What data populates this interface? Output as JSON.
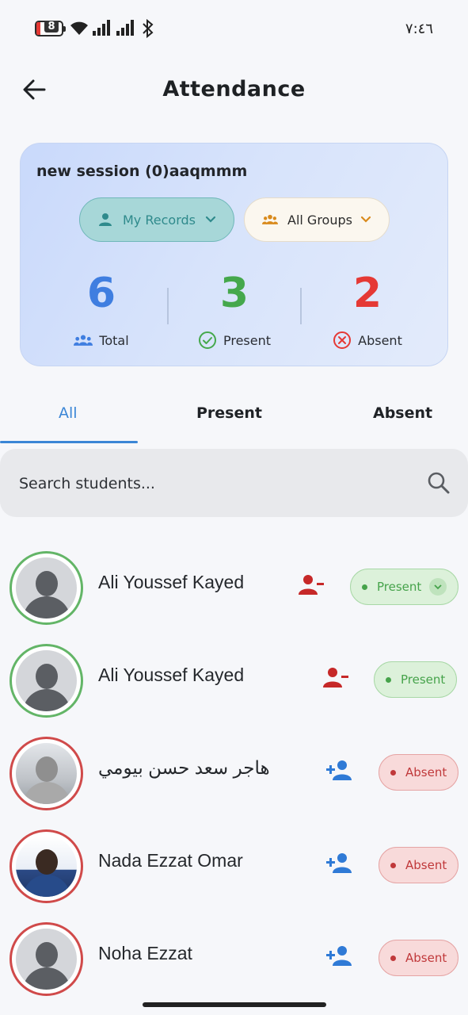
{
  "status_bar": {
    "battery": "8",
    "time": "٧:٤٦"
  },
  "header": {
    "title": "Attendance",
    "back_icon": "arrow-left-icon"
  },
  "summary": {
    "session_name": "new session (0)aaqmmm",
    "filters": {
      "records_label": "My Records",
      "groups_label": "All Groups"
    },
    "stats": {
      "total": {
        "value": "6",
        "label": "Total"
      },
      "present": {
        "value": "3",
        "label": "Present"
      },
      "absent": {
        "value": "2",
        "label": "Absent"
      }
    }
  },
  "tabs": [
    "All",
    "Present",
    "Absent"
  ],
  "active_tab": "All",
  "search": {
    "placeholder": "Search students..."
  },
  "students": [
    {
      "name": "Ali Youssef Kayed",
      "status": "Present"
    },
    {
      "name": "Ali Youssef Kayed",
      "status": "Present"
    },
    {
      "name": "هاجر سعد حسن بيومي",
      "status": "Absent"
    },
    {
      "name": "Nada Ezzat Omar",
      "status": "Absent"
    },
    {
      "name": "Noha Ezzat",
      "status": "Absent"
    }
  ],
  "colors": {
    "accent": "#3b86d6",
    "present": "#45a84c",
    "absent": "#e53935",
    "total": "#3f7ee0"
  }
}
